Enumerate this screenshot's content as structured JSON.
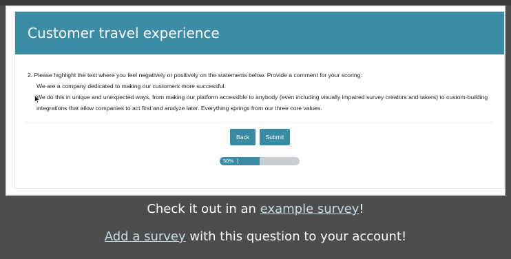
{
  "survey": {
    "title": "Customer travel experience",
    "question_title": "2. Please highlight the text where you feel negatively or positively on the statements below. Provide a comment for your scoring:",
    "paragraph1": "We are a company dedicated to making our customers more successful.",
    "paragraph2": "We do this in unique and unexpected ways, from making our platform accessible to anybody (even including visually impaired survey creators and takers) to custom-building integrations that allow companies to act first and analyze later. Everything springs from our three core values.",
    "back_label": "Back",
    "submit_label": "Submit",
    "progress_label": "50%",
    "progress_fraction": 0.5,
    "accent_color": "#3a8ca4"
  },
  "promo": {
    "line1_prefix": "Check it out in an ",
    "line1_link": "example survey",
    "line1_suffix": "!",
    "line2_link": "Add a survey",
    "line2_suffix": " with this question to your account!"
  }
}
